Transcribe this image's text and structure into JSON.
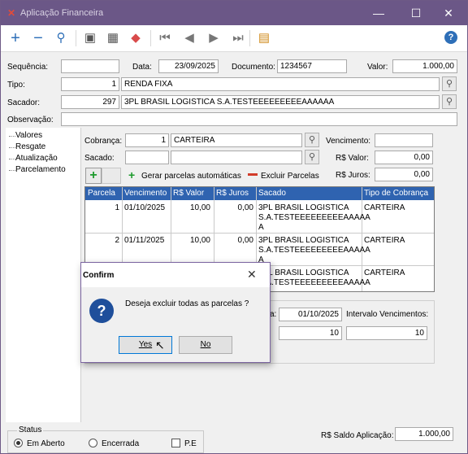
{
  "window": {
    "title": "Aplicação Financeira",
    "accent": "#6b5787",
    "header_blue": "#2f63b0"
  },
  "main": {
    "sequencia_label": "Sequência:",
    "sequencia_value": "",
    "data_label": "Data:",
    "data_value": "23/09/2025",
    "documento_label": "Documento:",
    "documento_value": "1234567",
    "valor_label": "Valor:",
    "valor_value": "1.000,00",
    "tipo_label": "Tipo:",
    "tipo_code": "1",
    "tipo_name": "RENDA FIXA",
    "sacador_label": "Sacador:",
    "sacador_code": "297",
    "sacador_name": "3PL BRASIL LOGISTICA S.A.TESTEEEEEEEEEAAAAAA",
    "observacao_label": "Observação:",
    "observacao_value": ""
  },
  "tree": {
    "items": [
      "Valores",
      "Resgate",
      "Atualização",
      "Parcelamento"
    ]
  },
  "parcelamento": {
    "cobranca_label": "Cobrança:",
    "cobranca_code": "1",
    "cobranca_name": "CARTEIRA",
    "sacado_label": "Sacado:",
    "sacado_code": "",
    "sacado_name": "",
    "vencimento_label": "Vencimento:",
    "vencimento_value": "",
    "rs_valor_label": "R$ Valor:",
    "rs_valor_value": "0,00",
    "rs_juros_label": "R$ Juros:",
    "rs_juros_value": "0,00",
    "gerar_label": "Gerar parcelas automáticas",
    "excluir_label": "Excluir Parcelas",
    "columns": [
      "Parcela",
      "Vencimento",
      "R$ Valor",
      "R$ Juros",
      "Sacado",
      "Tipo de Cobrança"
    ],
    "rows": [
      {
        "parcela": "1",
        "vencimento": "01/10/2025",
        "valor": "10,00",
        "juros": "0,00",
        "sacado_l1": "3PL BRASIL LOGISTICA",
        "sacado_l2": "S.A.TESTEEEEEEEEEAAAAA",
        "sacado_l3": "A",
        "tipo": "CARTEIRA"
      },
      {
        "parcela": "2",
        "vencimento": "01/11/2025",
        "valor": "10,00",
        "juros": "0,00",
        "sacado_l1": "3PL BRASIL LOGISTICA",
        "sacado_l2": "S.A.TESTEEEEEEEEEAAAAA",
        "sacado_l3": "A",
        "tipo": "CARTEIRA"
      },
      {
        "parcela": "",
        "vencimento": "",
        "valor": "",
        "juros": "",
        "sacado_l1": "3PL BRASIL LOGISTICA",
        "sacado_l2": "S.A.TESTEEEEEEEEEAAAAA",
        "sacado_l3": "",
        "tipo": "CARTEIRA"
      }
    ],
    "primeiro_venc_partial_label": "a:",
    "primeiro_venc_value": "01/10/2025",
    "intervalo_label": "Intervalo Vencimentos:",
    "qtd_value": "10",
    "intervalo_value": "10"
  },
  "dialog": {
    "title": "Confirm",
    "message": "Deseja excluir todas as parcelas ?",
    "yes_label": "Yes",
    "no_label": "No"
  },
  "status": {
    "group_label": "Status",
    "em_aberto_label": "Em Aberto",
    "encerrada_label": "Encerrada",
    "pe_label": "P.E",
    "selected": "Em Aberto",
    "saldo_label": "R$ Saldo Aplicação:",
    "saldo_value": "1.000,00"
  }
}
